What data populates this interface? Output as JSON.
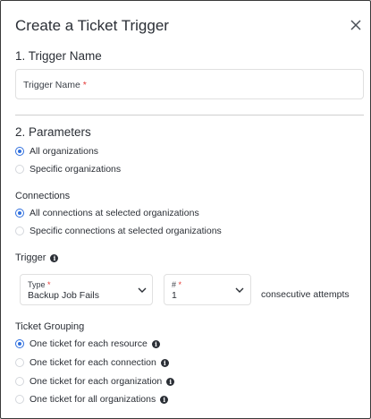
{
  "dialog": {
    "title": "Create a Ticket Trigger",
    "close_icon": "close-icon"
  },
  "trigger_name": {
    "section_title": "1. Trigger Name",
    "placeholder": "Trigger Name",
    "required_mark": "*",
    "value": ""
  },
  "parameters": {
    "section_title": "2. Parameters",
    "organizations": [
      {
        "label": "All organizations",
        "checked": true
      },
      {
        "label": "Specific organizations",
        "checked": false
      }
    ],
    "connections_label": "Connections",
    "connections": [
      {
        "label": "All connections at selected organizations",
        "checked": true
      },
      {
        "label": "Specific connections at selected organizations",
        "checked": false
      }
    ],
    "trigger_label": "Trigger",
    "trigger_type": {
      "label": "Type",
      "required_mark": "*",
      "value": "Backup Job Fails"
    },
    "trigger_count": {
      "label": "#",
      "required_mark": "*",
      "value": "1"
    },
    "consecutive_text": "consecutive attempts",
    "ticket_grouping_label": "Ticket Grouping",
    "ticket_grouping": [
      {
        "label": "One ticket for each resource",
        "checked": true
      },
      {
        "label": "One ticket for each connection",
        "checked": false
      },
      {
        "label": "One ticket for each organization",
        "checked": false
      },
      {
        "label": "One ticket for all organizations",
        "checked": false
      }
    ]
  },
  "colors": {
    "accent": "#2f6fde",
    "required": "#e53935",
    "text": "#2b2f36",
    "border": "#e0e0e0"
  }
}
